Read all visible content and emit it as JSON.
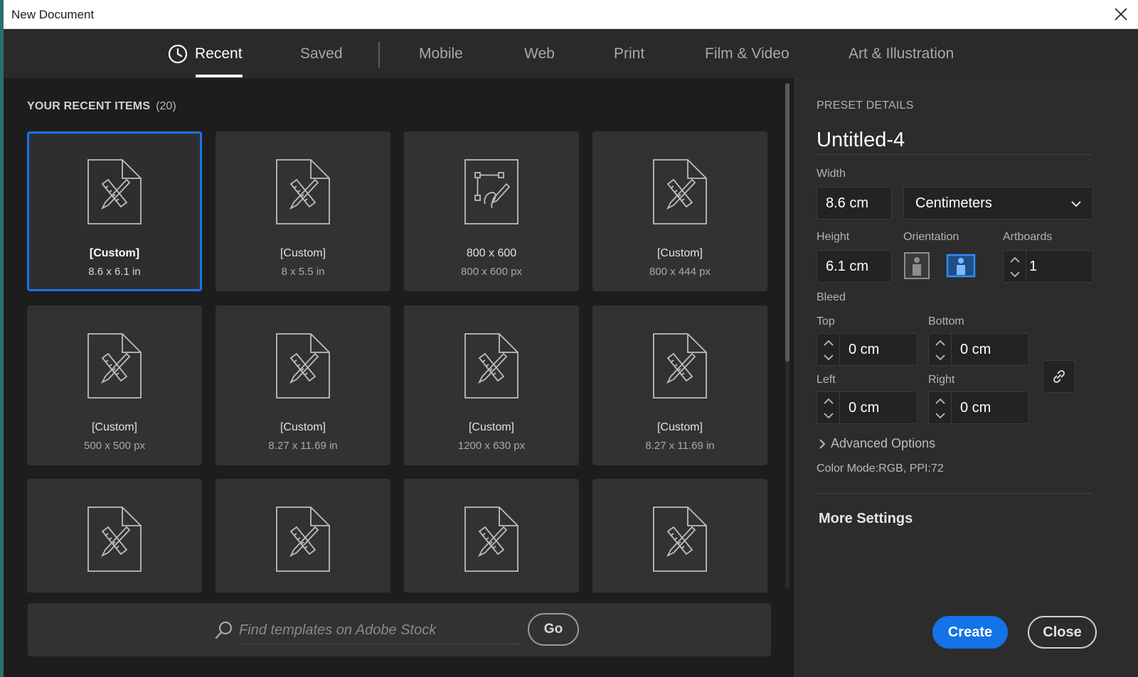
{
  "window": {
    "title": "New Document"
  },
  "tabs": [
    {
      "label": "Recent",
      "active": true,
      "icon": "clock-icon"
    },
    {
      "label": "Saved"
    },
    {
      "label": "Mobile"
    },
    {
      "label": "Web"
    },
    {
      "label": "Print"
    },
    {
      "label": "Film & Video"
    },
    {
      "label": "Art & Illustration"
    }
  ],
  "recent": {
    "header": "YOUR RECENT ITEMS",
    "count": "(20)",
    "items": [
      {
        "name": "[Custom]",
        "dims": "8.6 x 6.1 in",
        "icon": "document-ruler-pencil-icon",
        "selected": true
      },
      {
        "name": "[Custom]",
        "dims": "8 x 5.5 in",
        "icon": "document-ruler-pencil-icon"
      },
      {
        "name": "800 x 600",
        "dims": "800 x 600 px",
        "icon": "document-pen-path-icon"
      },
      {
        "name": "[Custom]",
        "dims": "800 x 444 px",
        "icon": "document-ruler-pencil-icon"
      },
      {
        "name": "[Custom]",
        "dims": "500 x 500 px",
        "icon": "document-ruler-pencil-icon"
      },
      {
        "name": "[Custom]",
        "dims": "8.27 x 11.69 in",
        "icon": "document-ruler-pencil-icon"
      },
      {
        "name": "[Custom]",
        "dims": "1200 x 630 px",
        "icon": "document-ruler-pencil-icon"
      },
      {
        "name": "[Custom]",
        "dims": "8.27 x 11.69 in",
        "icon": "document-ruler-pencil-icon"
      },
      {
        "name": "",
        "dims": "",
        "icon": "document-ruler-pencil-icon"
      },
      {
        "name": "",
        "dims": "",
        "icon": "document-ruler-pencil-icon"
      },
      {
        "name": "",
        "dims": "",
        "icon": "document-ruler-pencil-icon"
      },
      {
        "name": "",
        "dims": "",
        "icon": "document-ruler-pencil-icon"
      }
    ]
  },
  "search": {
    "placeholder": "Find templates on Adobe Stock",
    "go_label": "Go"
  },
  "preset": {
    "header": "PRESET DETAILS",
    "name": "Untitled-4",
    "width_label": "Width",
    "width_value": "8.6 cm",
    "units": "Centimeters",
    "height_label": "Height",
    "height_value": "6.1 cm",
    "orientation_label": "Orientation",
    "orientation_selected": "landscape",
    "artboards_label": "Artboards",
    "artboards_value": "1",
    "bleed_label": "Bleed",
    "bleed": {
      "top_label": "Top",
      "top_value": "0 cm",
      "bottom_label": "Bottom",
      "bottom_value": "0 cm",
      "left_label": "Left",
      "left_value": "0 cm",
      "right_label": "Right",
      "right_value": "0 cm"
    },
    "advanced_label": "Advanced Options",
    "color_mode": "Color Mode:RGB, PPI:72",
    "more_settings": "More Settings"
  },
  "actions": {
    "create": "Create",
    "close": "Close"
  },
  "colors": {
    "accent": "#1473e6",
    "selected_border": "#1b73e8",
    "panel": "#2c2c2c",
    "card": "#323232"
  }
}
